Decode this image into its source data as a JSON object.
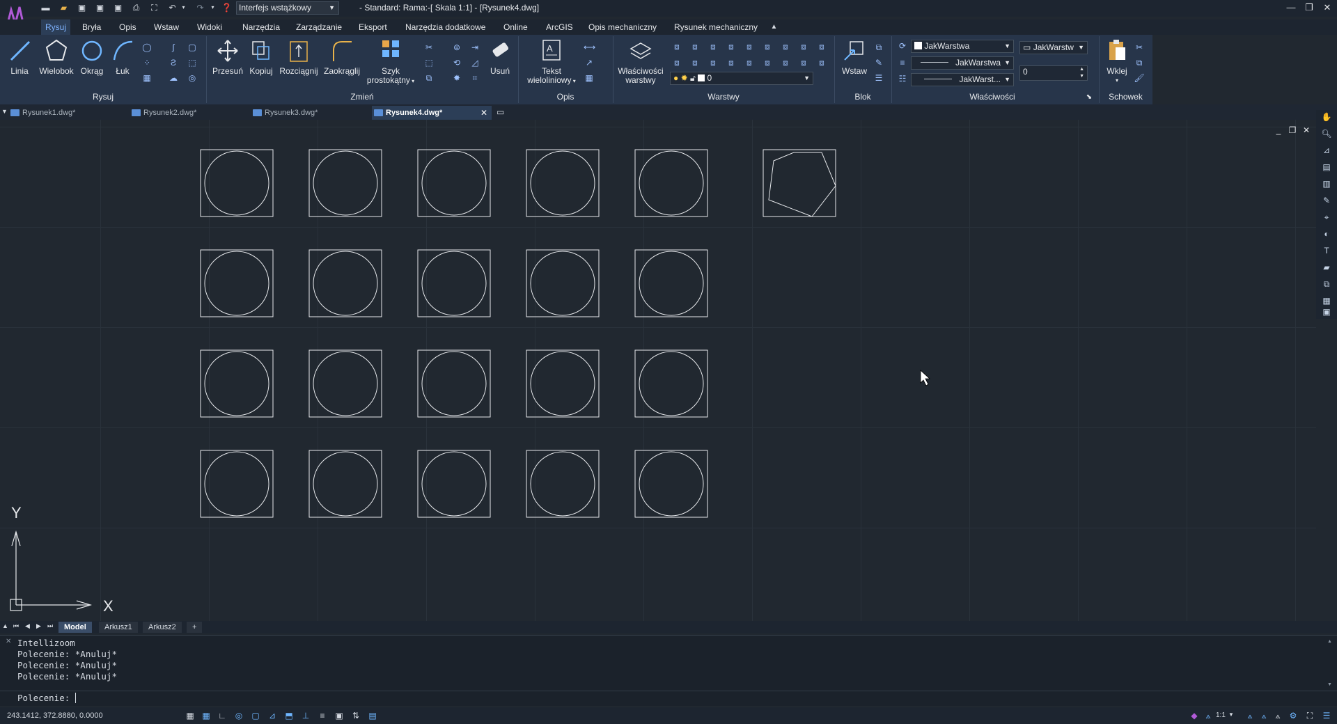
{
  "titlebar": {
    "interface_select": "Interfejs wstążkowy",
    "title": "- Standard: Rama:-[ Skala 1:1] - [Rysunek4.dwg]"
  },
  "menu": {
    "tabs": [
      "Rysuj",
      "Bryła",
      "Opis",
      "Wstaw",
      "Widoki",
      "Narzędzia",
      "Zarządzanie",
      "Eksport",
      "Narzędzia dodatkowe",
      "Online",
      "ArcGIS",
      "Opis mechaniczny",
      "Rysunek mechaniczny"
    ],
    "active": "Rysuj"
  },
  "ribbon": {
    "draw": {
      "linia": "Linia",
      "wielobok": "Wielobok",
      "okrag": "Okrąg",
      "luk": "Łuk",
      "group": "Rysuj"
    },
    "modify": {
      "przesun": "Przesuń",
      "kopiuj": "Kopiuj",
      "rozciagnij": "Rozciągnij",
      "zaokraglij": "Zaokrąglij",
      "szyk1": "Szyk",
      "szyk2": "prostokątny",
      "usun": "Usuń",
      "group": "Zmień"
    },
    "annot": {
      "tekst1": "Tekst",
      "tekst2": "wieloliniowy",
      "group": "Opis"
    },
    "layers": {
      "wlasc1": "Właściwości",
      "wlasc2": "warstwy",
      "layer_value": "0",
      "group": "Warstwy"
    },
    "block": {
      "wstaw": "Wstaw",
      "group": "Blok"
    },
    "props": {
      "color": "JakWarstwa",
      "linetype": "JakWarstwa",
      "lineweight": "JakWarst...",
      "plotstyle": "JakWarstw",
      "thickness": "0",
      "group": "Właściwości"
    },
    "clipboard": {
      "wklej": "Wklej",
      "group": "Schowek"
    }
  },
  "doc_tabs": [
    "Rysunek1.dwg*",
    "Rysunek2.dwg*",
    "Rysunek3.dwg*",
    "Rysunek4.dwg*"
  ],
  "active_doc": "Rysunek4.dwg*",
  "canvas": {
    "ucs_x": "X",
    "ucs_y": "Y"
  },
  "layout_tabs": [
    "Model",
    "Arkusz1",
    "Arkusz2",
    "+"
  ],
  "command": {
    "history": [
      "Intellizoom",
      "Polecenie: *Anuluj*",
      "Polecenie: *Anuluj*",
      "Polecenie: *Anuluj*"
    ],
    "prompt": "Polecenie: "
  },
  "status": {
    "coords": "243.1412, 372.8880, 0.0000",
    "scale": "1:1"
  },
  "colors": {
    "accent": "#7fb3ff",
    "ribbon": "#27354a",
    "canvas": "#212830"
  }
}
